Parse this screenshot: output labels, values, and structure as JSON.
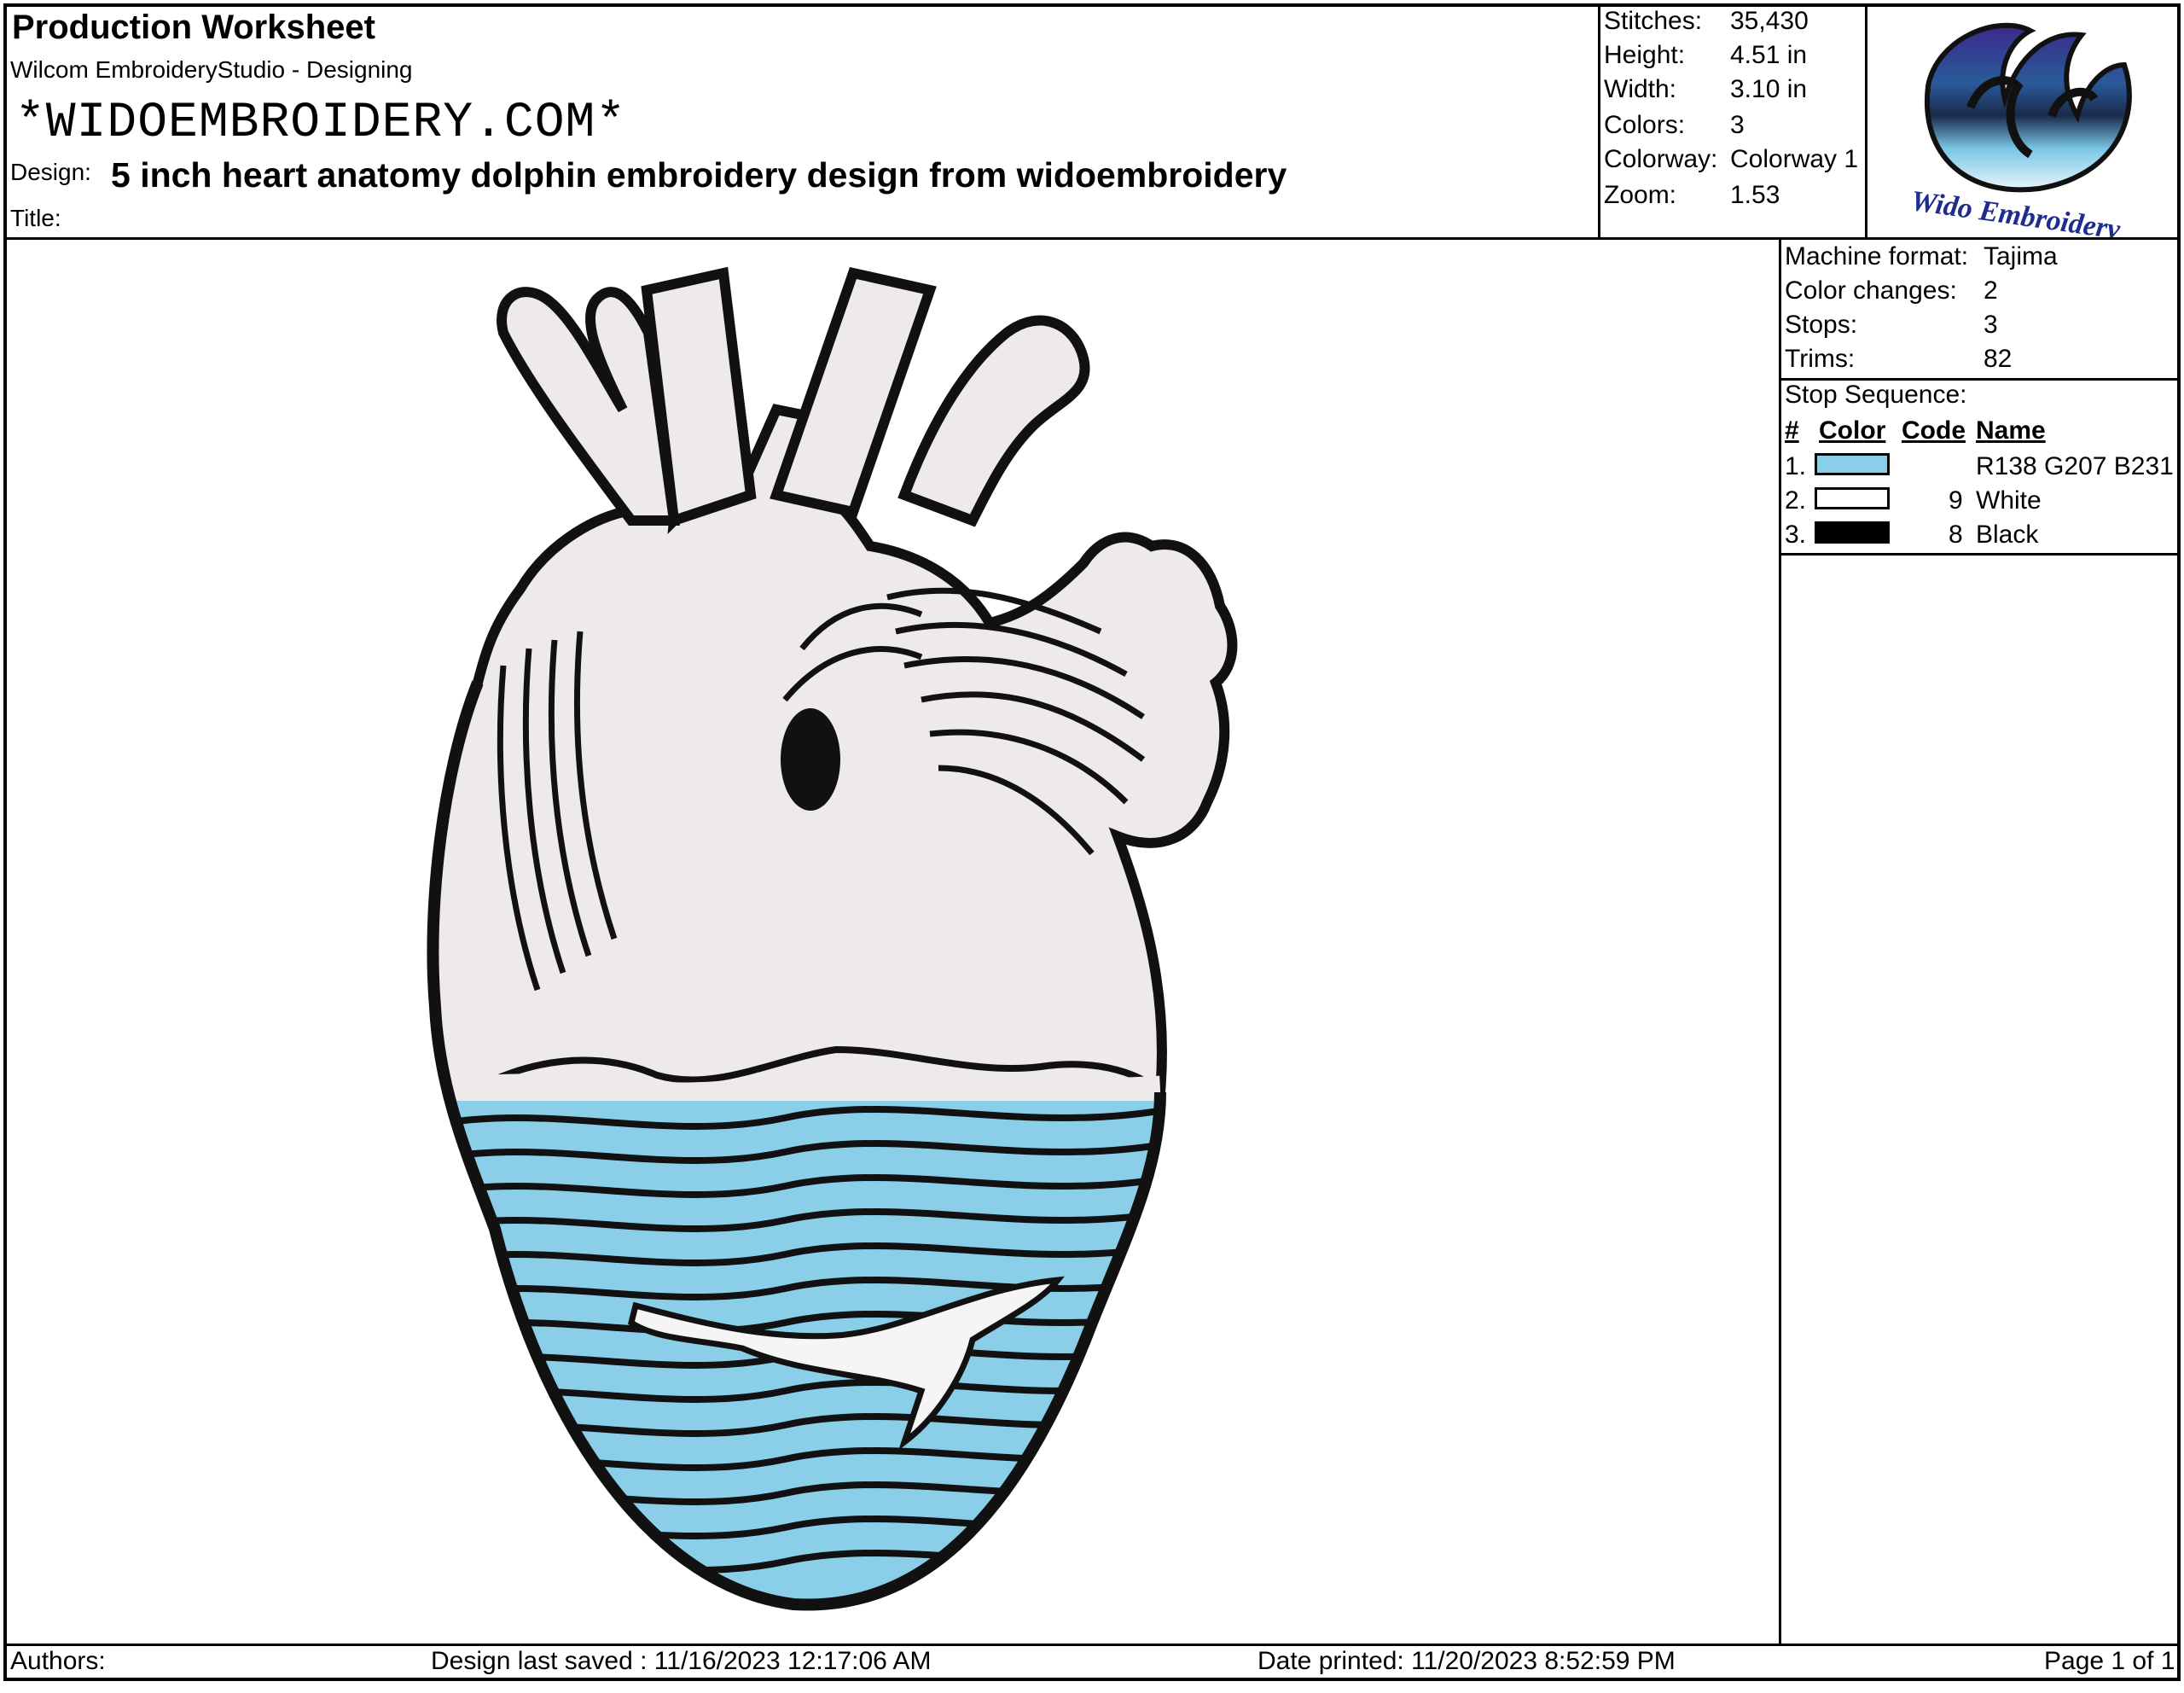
{
  "header": {
    "title": "Production Worksheet",
    "software": "Wilcom EmbroideryStudio - Designing",
    "watermark": "*WIDOEMBROIDERY.COM*",
    "design_label": "Design:",
    "design_name": "5 inch heart anatomy dolphin embroidery design from widoembroidery",
    "title_label": "Title:"
  },
  "stats": [
    {
      "label": "Stitches:",
      "value": "35,430"
    },
    {
      "label": "Height:",
      "value": "4.51 in"
    },
    {
      "label": "Width:",
      "value": "3.10 in"
    },
    {
      "label": "Colors:",
      "value": "3"
    },
    {
      "label": "Colorway:",
      "value": "Colorway 1"
    },
    {
      "label": "Zoom:",
      "value": "1.53"
    }
  ],
  "logo": {
    "text": "Wido Embroidery"
  },
  "machine": [
    {
      "label": "Machine format:",
      "value": "Tajima"
    },
    {
      "label": "Color changes:",
      "value": "2"
    },
    {
      "label": "Stops:",
      "value": "3"
    },
    {
      "label": "Trims:",
      "value": "82"
    }
  ],
  "stop_sequence": {
    "title": "Stop Sequence:",
    "headers": {
      "num": "#",
      "color": "Color",
      "code": "Code",
      "name": "Name"
    },
    "rows": [
      {
        "num": "1.",
        "swatch": "#8acfe7",
        "code": "",
        "name": "R138 G207 B231"
      },
      {
        "num": "2.",
        "swatch": "#ffffff",
        "code": "9",
        "name": "White"
      },
      {
        "num": "3.",
        "swatch": "#000000",
        "code": "8",
        "name": "Black"
      }
    ]
  },
  "colors": {
    "thread_blue": "#8acfe7",
    "thread_white": "#eeeaea",
    "thread_black": "#111111"
  },
  "footer": {
    "authors": "Authors:",
    "saved": "Design last saved : 11/16/2023 12:17:06 AM",
    "printed": "Date printed: 11/20/2023 8:52:59 PM",
    "page": "Page 1 of 1"
  }
}
